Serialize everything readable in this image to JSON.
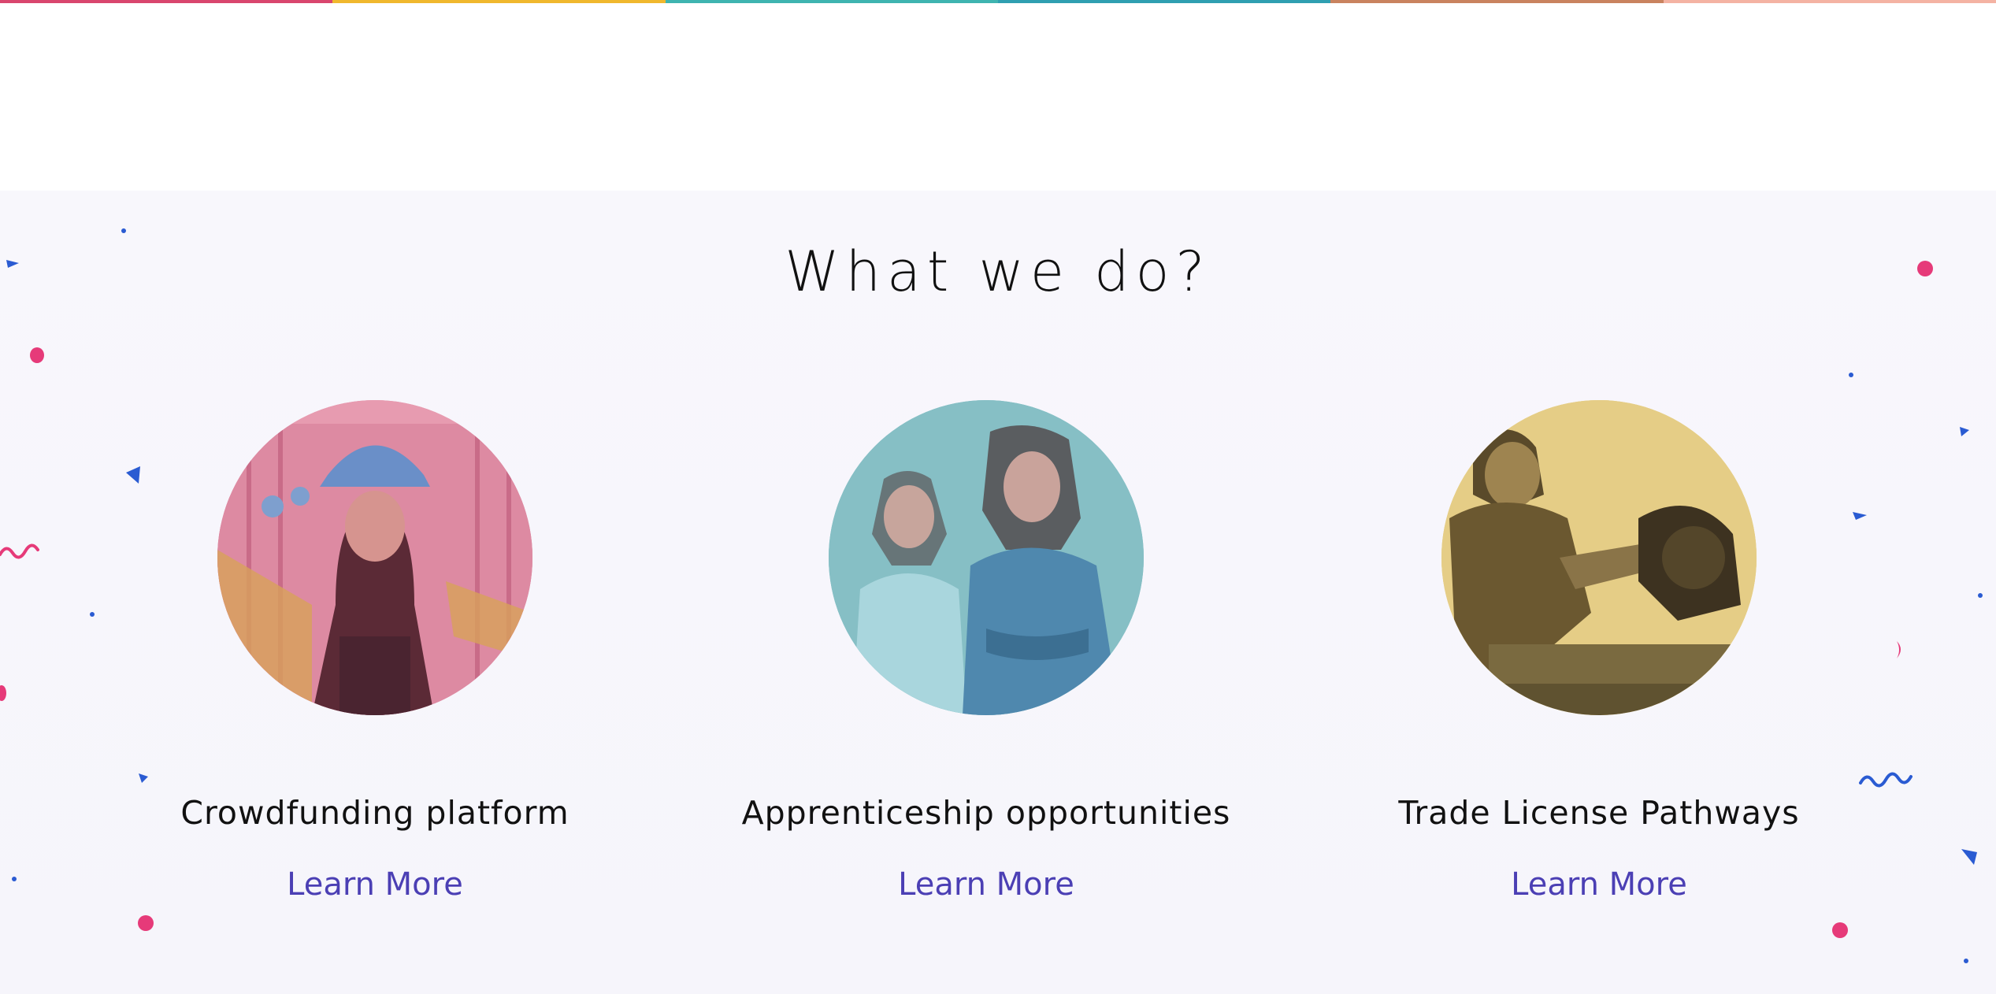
{
  "colorbar": [
    "#d9466e",
    "#f0b82e",
    "#3fb4b0",
    "#2f9fb1",
    "#c9835f",
    "#f4b3a3"
  ],
  "section": {
    "heading": "What we do?",
    "cards": [
      {
        "title": "Crowdfunding platform",
        "link": "Learn More",
        "tint": "#e48aa3",
        "image": "woman-hard-hat-photo"
      },
      {
        "title": "Apprenticeship opportunities",
        "link": "Learn More",
        "tint": "#7dbdc3",
        "image": "two-young-women-photo"
      },
      {
        "title": "Trade License Pathways",
        "link": "Learn More",
        "tint": "#e8cf86",
        "image": "worker-miter-saw-photo"
      }
    ]
  },
  "colors": {
    "accent": "#4b3fb4",
    "pink": "#e63a79",
    "blue": "#2a5bd2"
  }
}
